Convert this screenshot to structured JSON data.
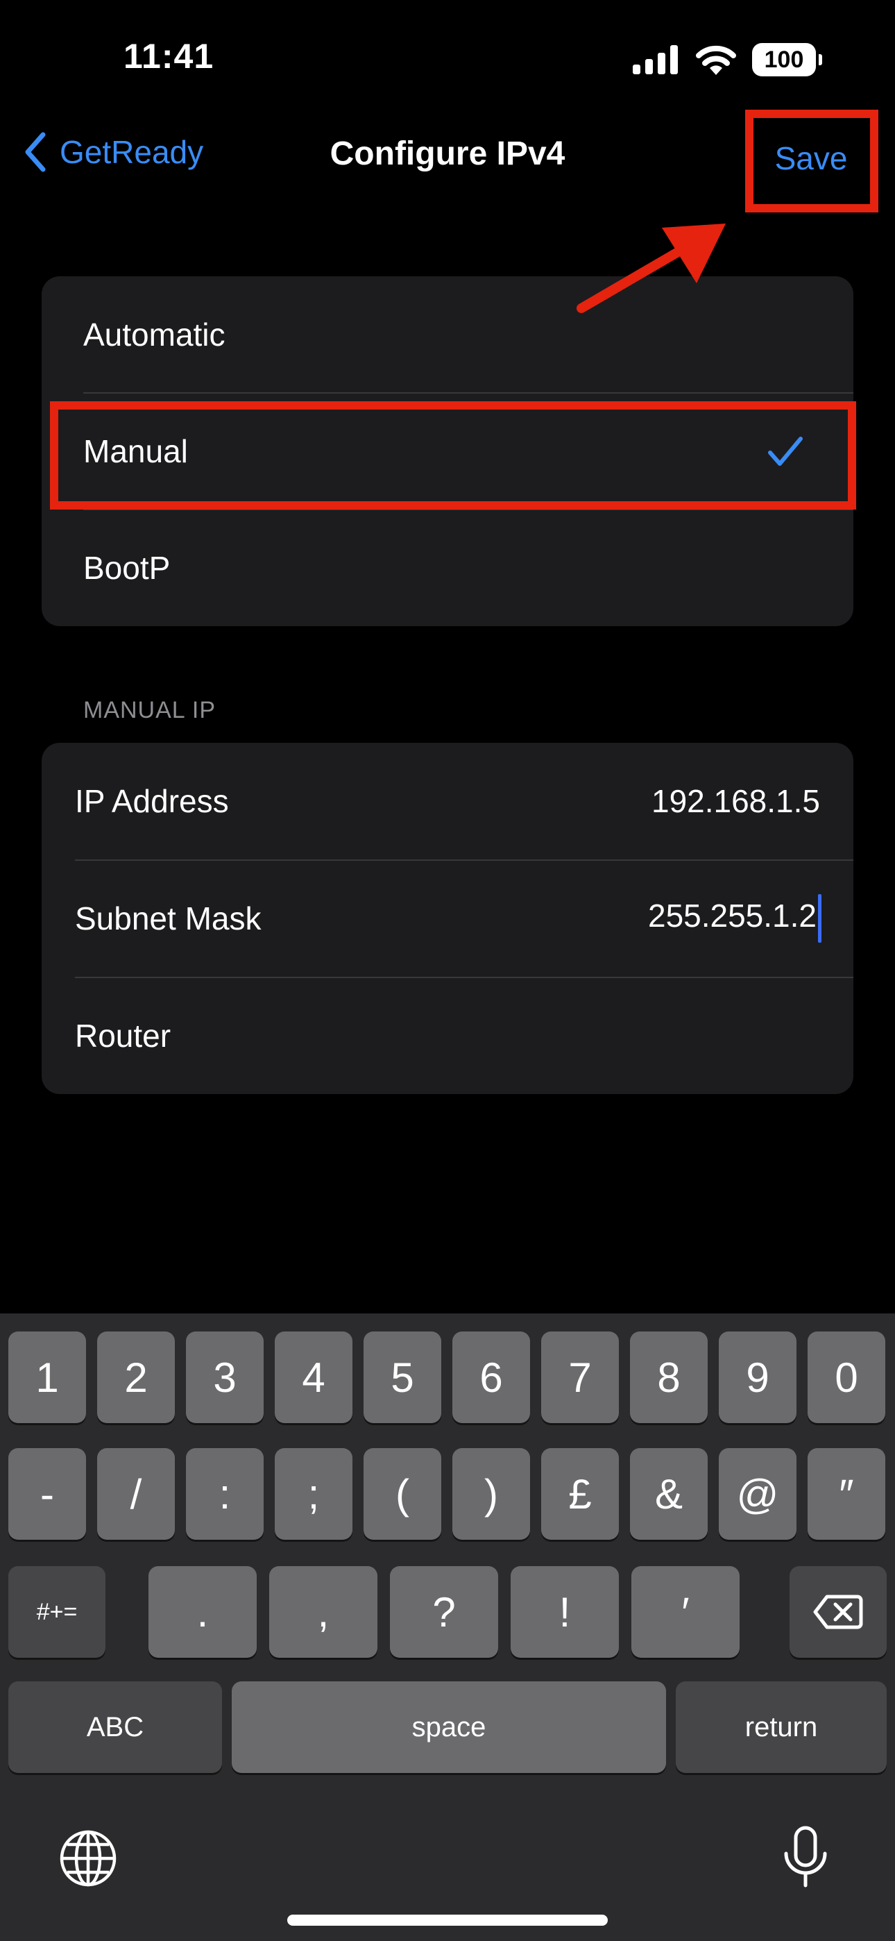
{
  "status_bar": {
    "time": "11:41",
    "battery": "100"
  },
  "nav": {
    "back_label": "GetReady",
    "title": "Configure IPv4",
    "save_label": "Save"
  },
  "config_options": [
    {
      "label": "Automatic",
      "selected": false
    },
    {
      "label": "Manual",
      "selected": true
    },
    {
      "label": "BootP",
      "selected": false
    }
  ],
  "manual_ip": {
    "header": "MANUAL IP",
    "fields": [
      {
        "label": "IP Address",
        "value": "192.168.1.5"
      },
      {
        "label": "Subnet Mask",
        "value": "255.255.1.2"
      },
      {
        "label": "Router",
        "value": ""
      }
    ]
  },
  "keyboard": {
    "row1": [
      "1",
      "2",
      "3",
      "4",
      "5",
      "6",
      "7",
      "8",
      "9",
      "0"
    ],
    "row2": [
      "-",
      "/",
      ":",
      ";",
      "(",
      ")",
      "£",
      "&",
      "@",
      "″"
    ],
    "row3_mode": "#+=",
    "row3": [
      ".",
      ",",
      "?",
      "!",
      "′"
    ],
    "abc_label": "ABC",
    "space_label": "space",
    "return_label": "return"
  },
  "colors": {
    "accent": "#3a8cf5",
    "annotation": "#e5230f",
    "card": "#1c1c1e",
    "key": "#6b6b6e",
    "keyboard_bg": "#2b2b2d"
  }
}
